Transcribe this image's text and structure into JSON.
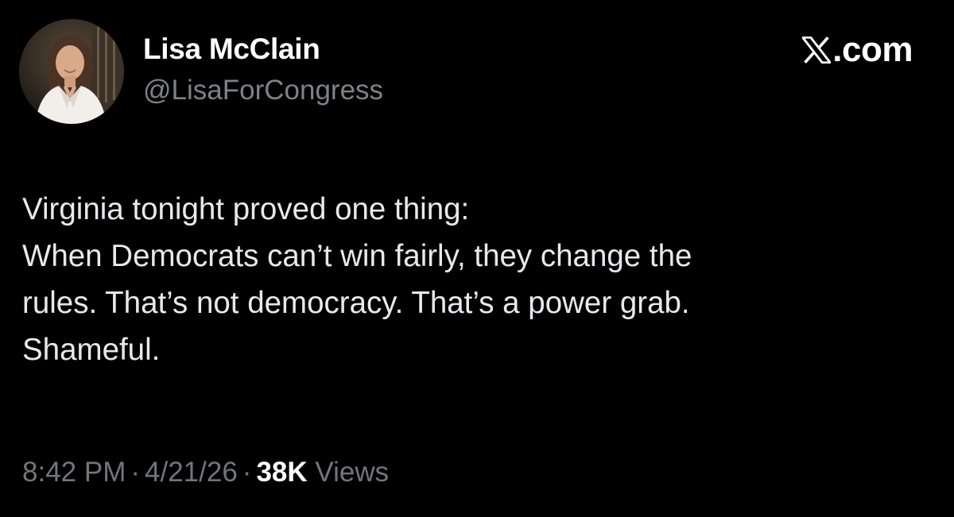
{
  "author": {
    "display_name": "Lisa McClain",
    "handle": "@LisaForCongress",
    "avatar_icon": "profile-photo"
  },
  "brand": {
    "label": ".com",
    "icon": "x-logo-icon"
  },
  "tweet": {
    "lines": [
      "Virginia tonight proved one thing:",
      "When Democrats can’t win fairly, they change the",
      "rules. That’s not democracy. That’s a power grab.",
      "Shameful."
    ]
  },
  "meta": {
    "time": "8:42 PM",
    "date": "4/21/26",
    "separator": "·",
    "views_count": "38K",
    "views_label": "Views"
  },
  "colors": {
    "background": "#000000",
    "primary_text": "#e7e9ea",
    "secondary_text": "#71767b",
    "name_text": "#ffffff"
  }
}
